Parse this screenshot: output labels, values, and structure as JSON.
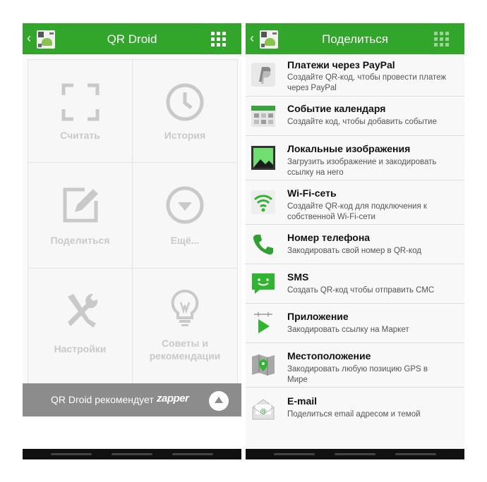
{
  "left_screen": {
    "title": "QR Droid",
    "tiles": [
      {
        "label": "Считать",
        "icon": "scan-frame-icon"
      },
      {
        "label": "История",
        "icon": "clock-icon"
      },
      {
        "label": "Поделиться",
        "icon": "edit-icon"
      },
      {
        "label": "Ещё...",
        "icon": "chevron-down-circle-icon"
      },
      {
        "label": "Настройки",
        "icon": "tools-icon"
      },
      {
        "label_line1": "Советы и",
        "label_line2": "рекомендации",
        "icon": "lightbulb-icon"
      }
    ],
    "promo": {
      "text": "QR Droid рекомендует",
      "brand": "zapper"
    }
  },
  "right_screen": {
    "title": "Поделиться",
    "items": [
      {
        "title": "Платежи через PayPal",
        "sub1": "Создайте QR-код, чтобы провести платеж",
        "sub2": "через PayPal",
        "icon": "paypal-icon"
      },
      {
        "title": "Событие календаря",
        "sub1": "Создайте код, чтобы добавить событие",
        "sub2": "",
        "icon": "calendar-icon"
      },
      {
        "title": "Локальные изображения",
        "sub1": "Загрузить изображение и закодировать",
        "sub2": "ссылку на него",
        "icon": "image-icon"
      },
      {
        "title": "Wi-Fi-сеть",
        "sub1": "Создайте QR-код для подключения к",
        "sub2": "собственной Wi-Fi-сети",
        "icon": "wifi-icon"
      },
      {
        "title": "Номер телефона",
        "sub1": "Закодировать свой номер в QR-код",
        "sub2": "",
        "icon": "phone-icon"
      },
      {
        "title": "SMS",
        "sub1": "Создать QR-код чтобы отправить СМС",
        "sub2": "",
        "icon": "sms-icon"
      },
      {
        "title": "Приложение",
        "sub1": "Закодировать ссылку на Маркет",
        "sub2": "",
        "icon": "play-market-icon"
      },
      {
        "title": "Местоположение",
        "sub1": "Закодировать любую позицию GPS в",
        "sub2": "Мире",
        "icon": "map-location-icon"
      },
      {
        "title": "E-mail",
        "sub1": "Поделиться email адресом и темой",
        "sub2": "",
        "icon": "email-icon"
      }
    ]
  },
  "colors": {
    "accent": "#32a62a",
    "promo_bg": "#8c8c8c",
    "tile_icon": "#c9c9c9"
  }
}
